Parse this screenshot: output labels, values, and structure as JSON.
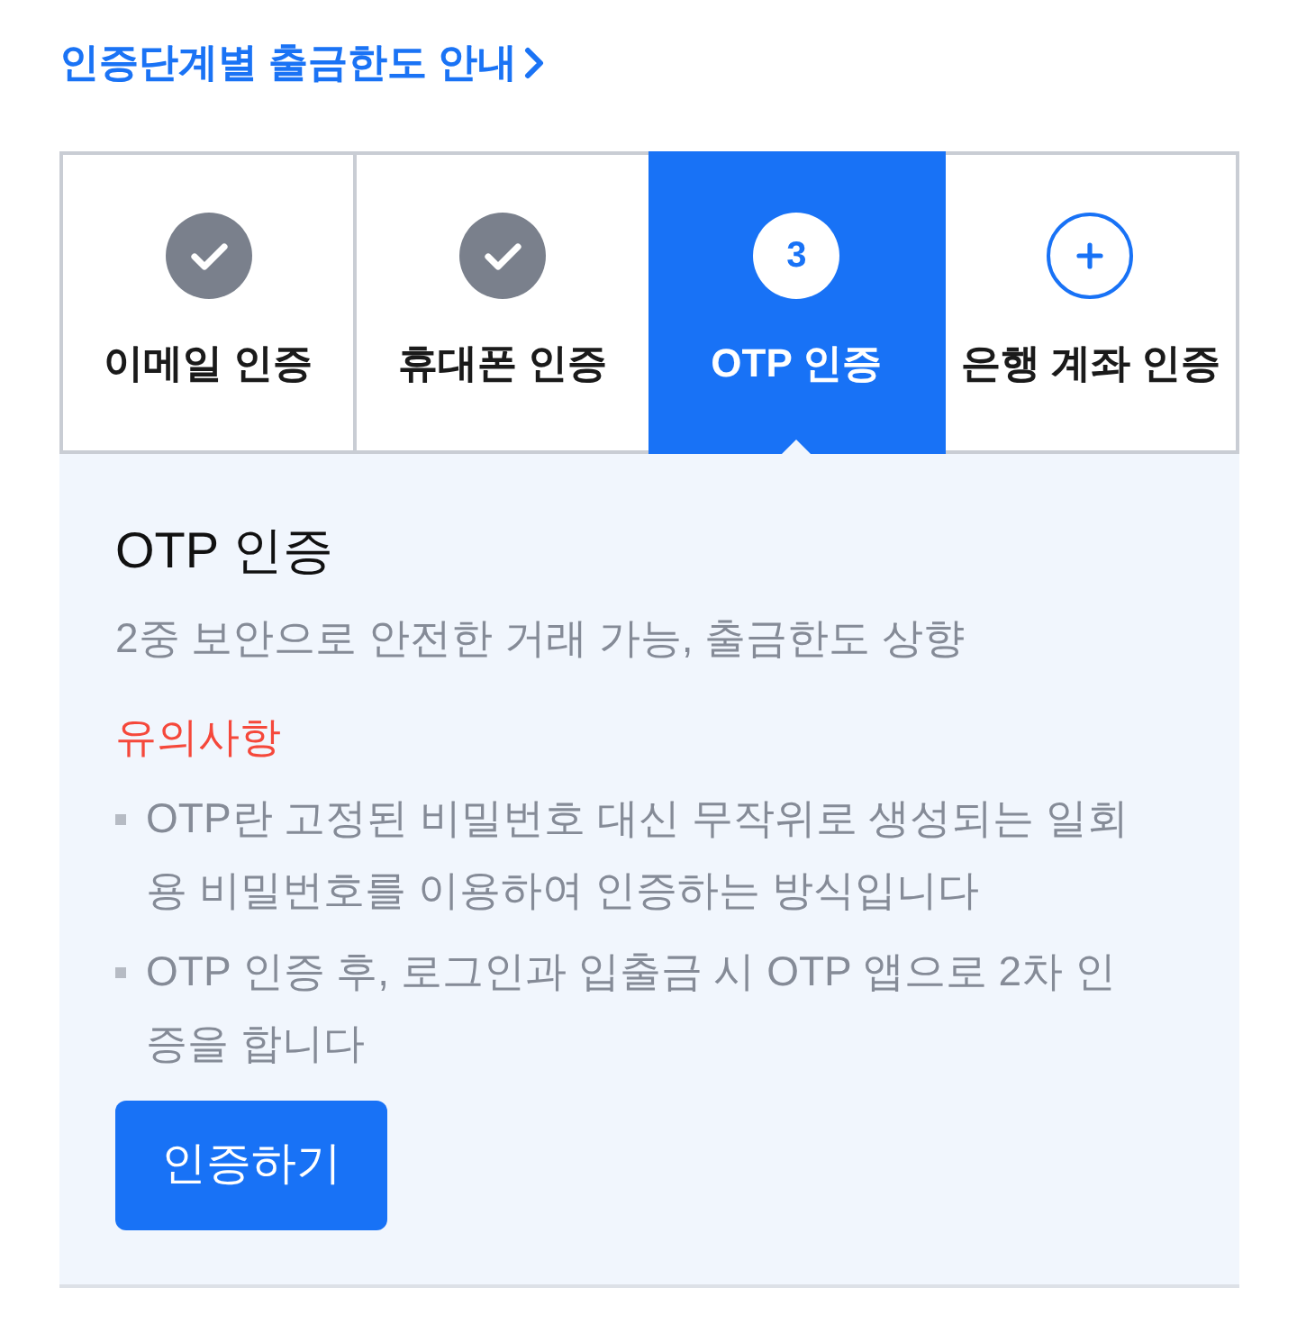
{
  "guide_link": {
    "label": "인증단계별 출금한도 안내"
  },
  "steps": [
    {
      "label": "이메일 인증",
      "kind": "done",
      "selected": false
    },
    {
      "label": "휴대폰 인증",
      "kind": "done",
      "selected": false
    },
    {
      "label": "OTP 인증",
      "kind": "current",
      "number": "3",
      "selected": true
    },
    {
      "label": "은행 계좌 인증",
      "kind": "todo",
      "selected": false
    }
  ],
  "detail": {
    "title": "OTP 인증",
    "subtitle": "2중 보안으로 안전한 거래 가능, 출금한도 상향",
    "notice_title": "유의사항",
    "notices": [
      "OTP란 고정된 비밀번호 대신 무작위로 생성되는 일회용 비밀번호를 이용하여 인증하는 방식입니다",
      "OTP 인증 후, 로그인과 입출금 시 OTP 앱으로 2차 인증을 합니다"
    ],
    "button": "인증하기"
  }
}
